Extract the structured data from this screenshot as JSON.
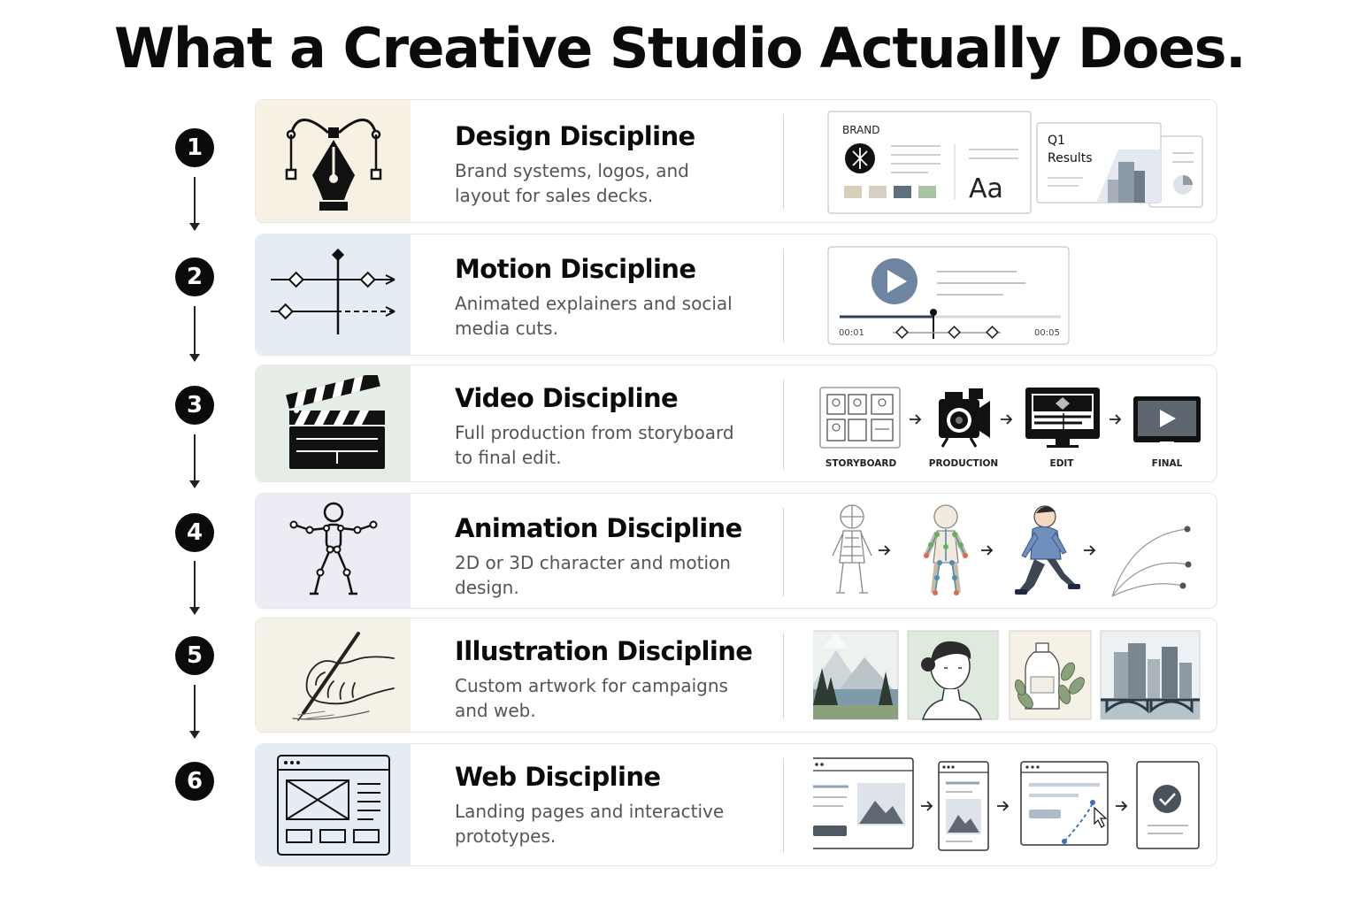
{
  "title": "What a Creative Studio Actually Does.",
  "colors": {
    "design_bg": "#f7f1e4",
    "motion_bg": "#e6ecf4",
    "video_bg": "#e6ede6",
    "animation_bg": "#efebf4",
    "illustration_bg": "#f6f1e6",
    "web_bg": "#e6ecf3",
    "accent_blue": "#6f86a3"
  },
  "steps": [
    {
      "number": "1",
      "title": "Design Discipline",
      "description": "Brand systems, logos, and layout for sales decks.",
      "icon": "pen-tool-icon",
      "visual": {
        "brand_label": "BRAND",
        "type_sample": "Aa",
        "deck_label_line1": "Q1",
        "deck_label_line2": "Results"
      }
    },
    {
      "number": "2",
      "title": "Motion Discipline",
      "description": "Animated explainers and social media cuts.",
      "icon": "keyframe-timeline-icon",
      "visual": {
        "time_start": "00:01",
        "time_end": "00:05"
      }
    },
    {
      "number": "3",
      "title": "Video Discipline",
      "description": "Full production from storyboard to final edit.",
      "icon": "clapperboard-icon",
      "visual": {
        "stages": [
          "STORYBOARD",
          "PRODUCTION",
          "EDIT",
          "FINAL"
        ]
      }
    },
    {
      "number": "4",
      "title": "Animation Discipline",
      "description": "2D or 3D character and motion design.",
      "icon": "rig-figure-icon",
      "visual": {
        "stages": [
          "mesh",
          "rig",
          "character",
          "motion-curves"
        ]
      }
    },
    {
      "number": "5",
      "title": "Illustration Discipline",
      "description": "Custom artwork for campaigns and web.",
      "icon": "hand-drawing-icon",
      "visual": {
        "artworks": [
          "landscape",
          "portrait",
          "botanical-bottle",
          "cityscape"
        ]
      }
    },
    {
      "number": "6",
      "title": "Web Discipline",
      "description": "Landing pages and interactive prototypes.",
      "icon": "browser-wireframe-icon",
      "visual": {
        "stages": [
          "desktop",
          "mobile",
          "prototype",
          "confirmed"
        ]
      }
    }
  ]
}
